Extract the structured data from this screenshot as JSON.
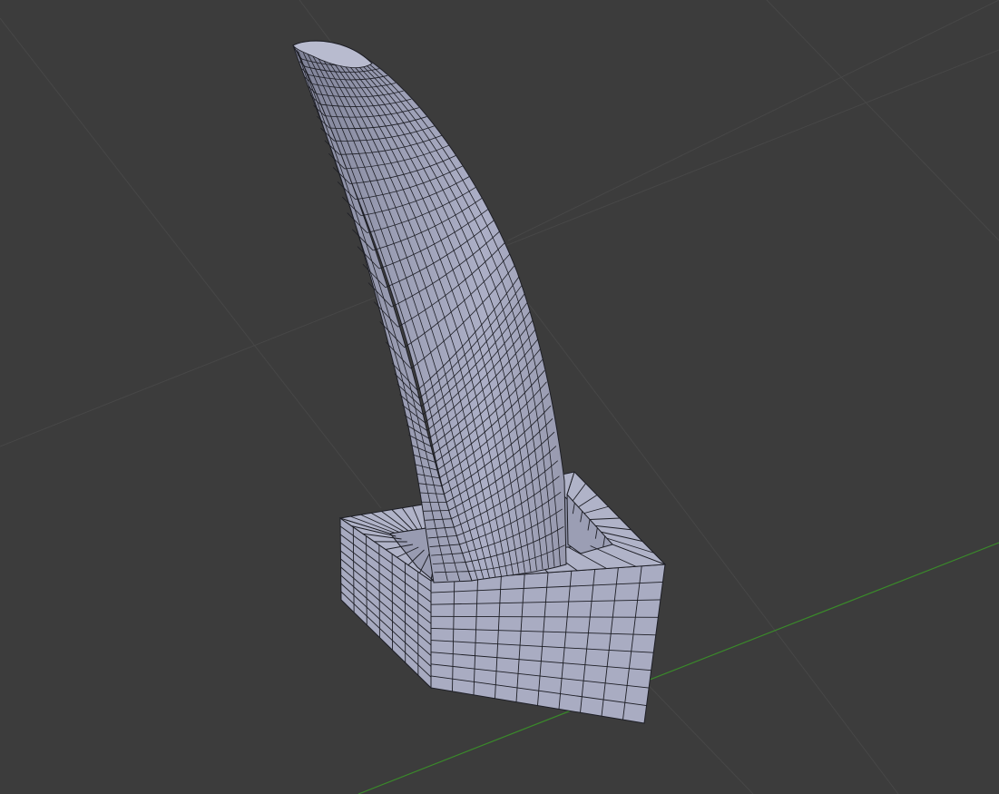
{
  "viewport": {
    "background_color": "#3c3c3c",
    "grid_line_color": "#474747",
    "x_axis_color": "#3a8a2a",
    "mesh_face_color": "#a3a7bf",
    "mesh_face_shade_color": "#7c7f95",
    "mesh_face_dark_color": "#5f6275",
    "wire_color": "#1d1e25",
    "edge_highlight_color": "#d9dcec"
  },
  "mesh": {
    "name_icon": "mesh-object-icon",
    "parts": [
      "horn-mesh",
      "socket-base-mesh"
    ]
  }
}
